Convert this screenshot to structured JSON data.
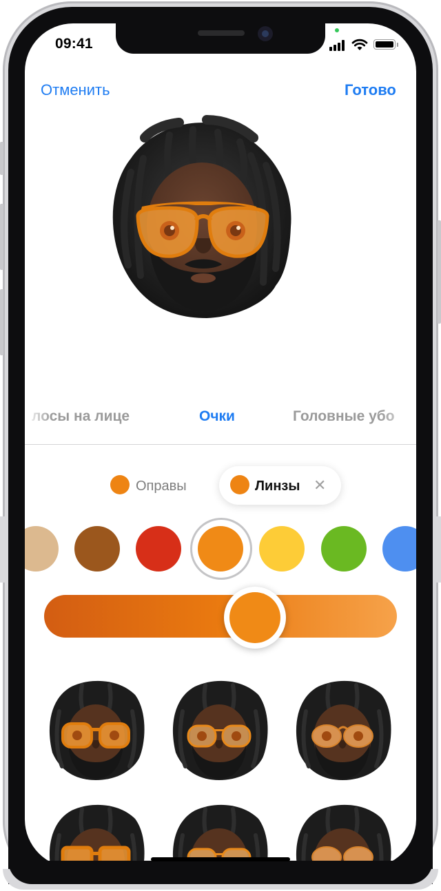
{
  "status_bar": {
    "time": "09:41"
  },
  "nav": {
    "cancel_label": "Отменить",
    "done_label": "Готово"
  },
  "categories": [
    {
      "label": "лосы на лице",
      "active": false
    },
    {
      "label": "Очки",
      "active": true
    },
    {
      "label": "Головные убо",
      "active": false
    }
  ],
  "segments": {
    "frames_label": "Оправы",
    "lenses_label": "Линзы",
    "selected": "Линзы",
    "close_glyph": "✕"
  },
  "swatches": [
    "#dcb98f",
    "#9b571d",
    "#d72f18",
    "#f08a16",
    "#fdcc37",
    "#6ab922",
    "#4e8ff0"
  ],
  "selected_swatch": "#f08a16",
  "lens_opacity_slider": {
    "value": 0.55
  },
  "colors": {
    "accent": "#1e7cf2",
    "lens_orange": "#f08a16"
  }
}
